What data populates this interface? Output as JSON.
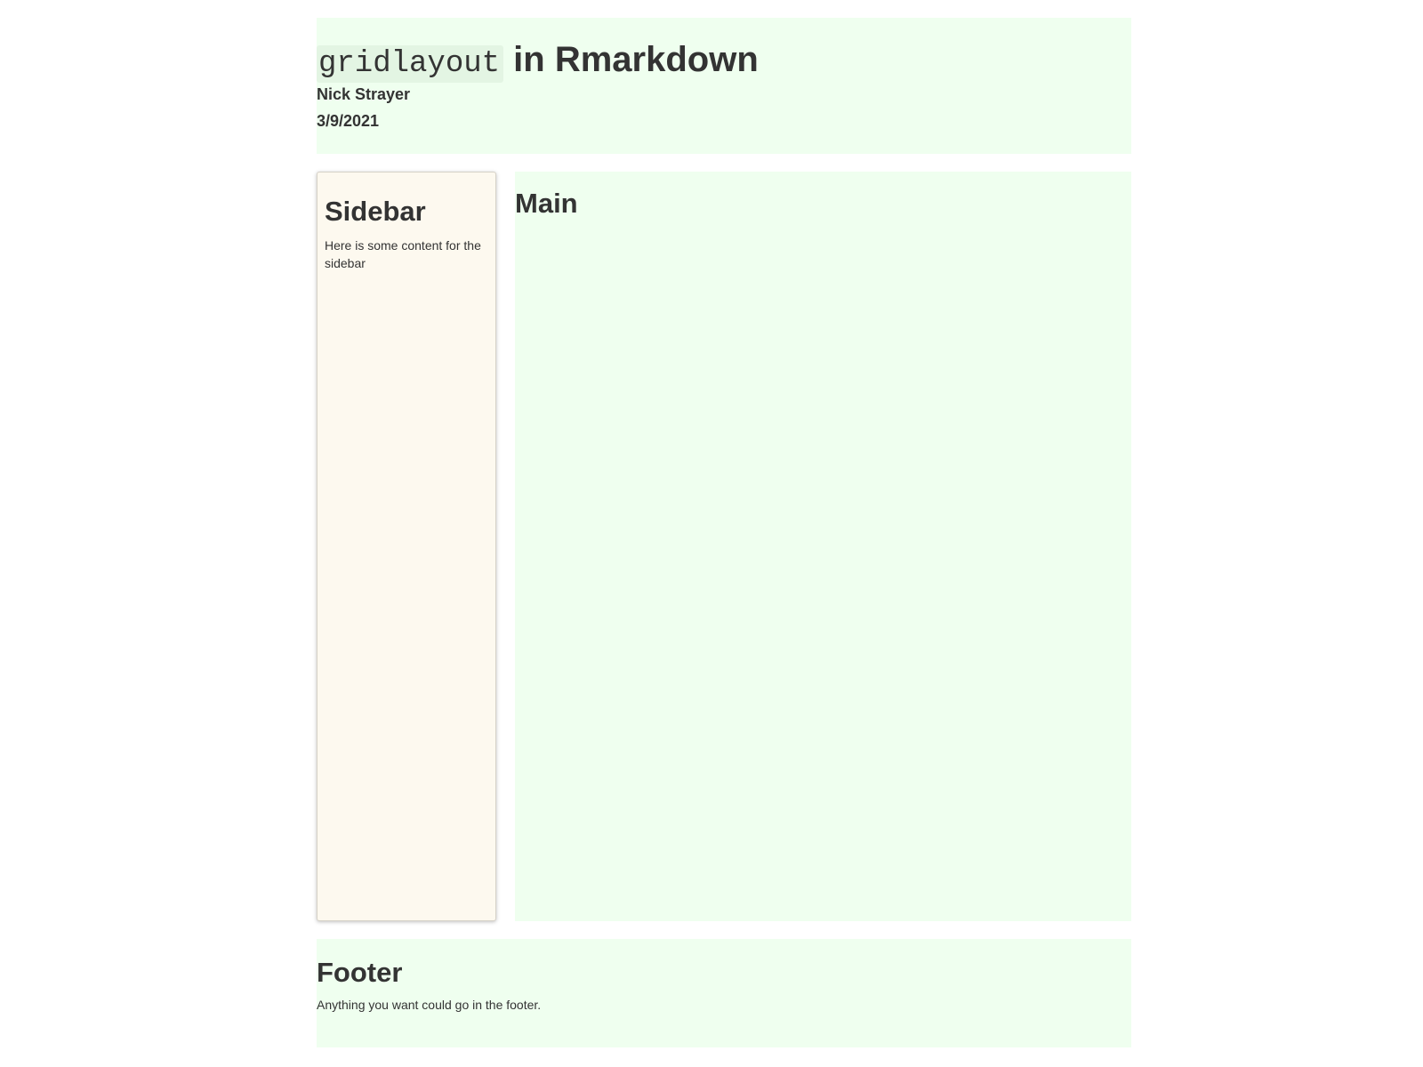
{
  "header": {
    "title_code": "gridlayout",
    "title_rest": " in Rmarkdown",
    "author": "Nick Strayer",
    "date": "3/9/2021"
  },
  "sidebar": {
    "heading": "Sidebar",
    "text": "Here is some content for the sidebar"
  },
  "main": {
    "heading": "Main"
  },
  "footer": {
    "heading": "Footer",
    "text": "Anything you want could go in the footer."
  },
  "colors": {
    "panel_green": "#efffef",
    "sidebar_cream": "#fdf9ef",
    "text": "#333333"
  }
}
